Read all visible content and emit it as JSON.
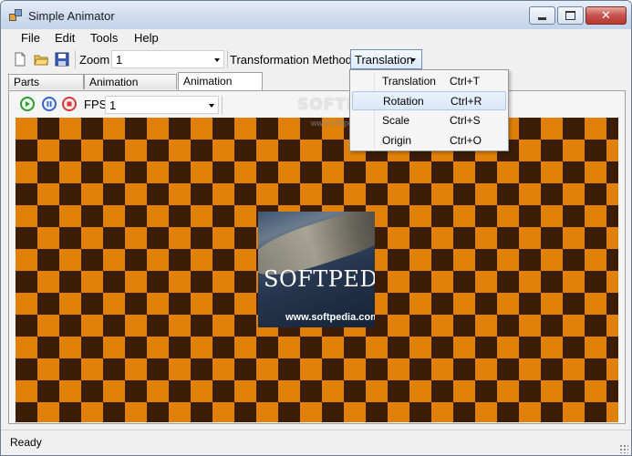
{
  "window": {
    "title": "Simple Animator"
  },
  "menubar": {
    "items": [
      "File",
      "Edit",
      "Tools",
      "Help"
    ]
  },
  "toolbar": {
    "zoom_label": "Zoom",
    "zoom_value": "1",
    "transformation_label": "Transformation Method",
    "transformation_value": "Translation"
  },
  "tabs": [
    {
      "label": "Parts Designer",
      "active": false
    },
    {
      "label": "Animation Designer",
      "active": false
    },
    {
      "label": "Animation Viewer",
      "active": true
    }
  ],
  "viewer": {
    "fps_label": "FPS",
    "fps_value": "1"
  },
  "sprite": {
    "word": "SOFTPEDIA",
    "url": "www.softpedia.com"
  },
  "watermark": {
    "text": "SOFTPEDIA",
    "url": "www.softpedia.com"
  },
  "dropdown_menu": {
    "items": [
      {
        "label": "Translation",
        "shortcut": "Ctrl+T",
        "highlighted": false
      },
      {
        "label": "Rotation",
        "shortcut": "Ctrl+R",
        "highlighted": true
      },
      {
        "label": "Scale",
        "shortcut": "Ctrl+S",
        "highlighted": false
      },
      {
        "label": "Origin",
        "shortcut": "Ctrl+O",
        "highlighted": false
      }
    ]
  },
  "status": {
    "text": "Ready"
  },
  "colors": {
    "checker_light": "#e08006",
    "checker_dark": "#3b1d08",
    "play": "#2e9a2e",
    "pause": "#3a63c8",
    "stop": "#d23a3a",
    "menu_highlight": "#d9e8f8"
  },
  "icons": [
    "app-icon",
    "new-file-icon",
    "open-folder-icon",
    "save-disk-icon",
    "play-icon",
    "pause-icon",
    "stop-icon",
    "resize-grip-icon"
  ]
}
